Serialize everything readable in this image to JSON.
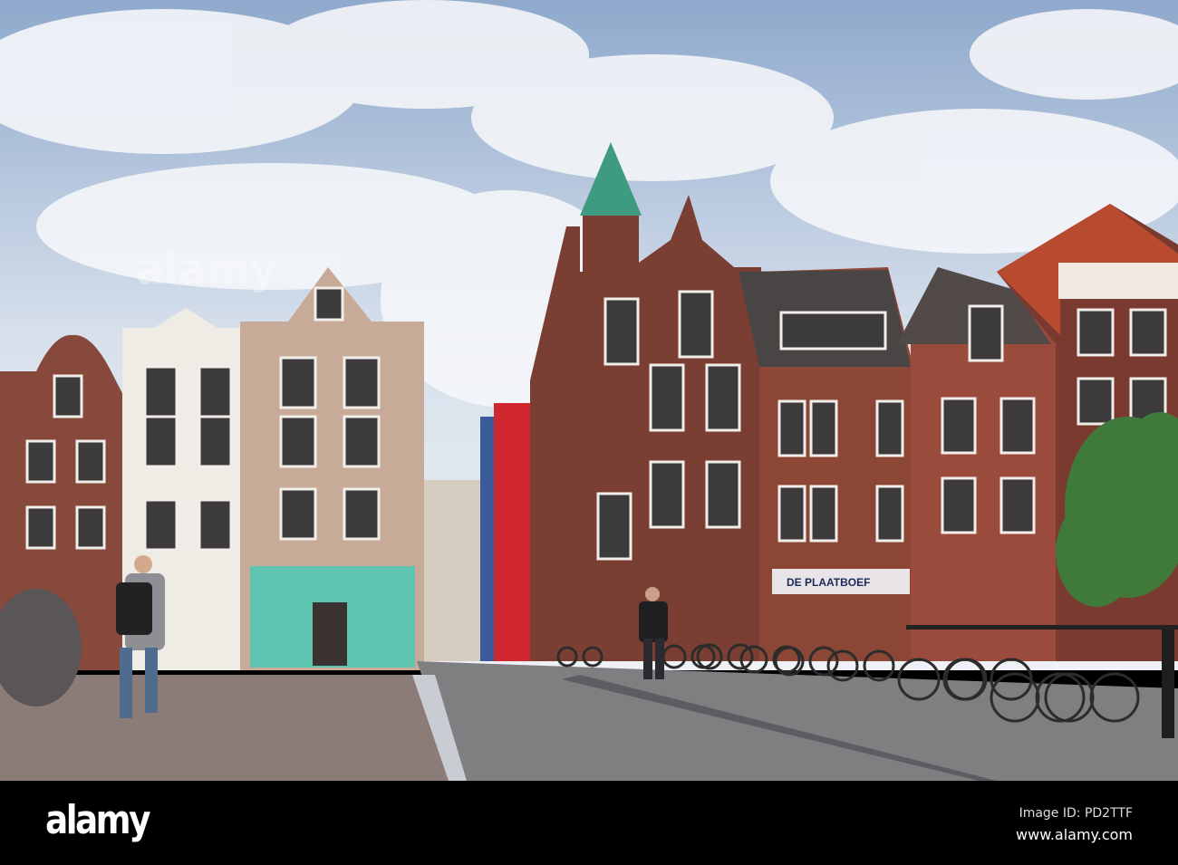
{
  "photo": {
    "subject": "Utrecht canal-side street with gabled houses and bicycles",
    "shop_sign": "DE PLAATBOEF",
    "colors": {
      "sky": "#c9d6e6",
      "cloud": "#f2f4f7",
      "road": "#8a7f7a",
      "brick": "#7e3f33",
      "spire": "#3f9a82",
      "scaffold": "#d0262e",
      "shopfront": "#5fc4b0"
    }
  },
  "watermark": {
    "logo": "alamy",
    "image_id": "Image ID: PD2TTF",
    "url": "www.alamy.com"
  }
}
